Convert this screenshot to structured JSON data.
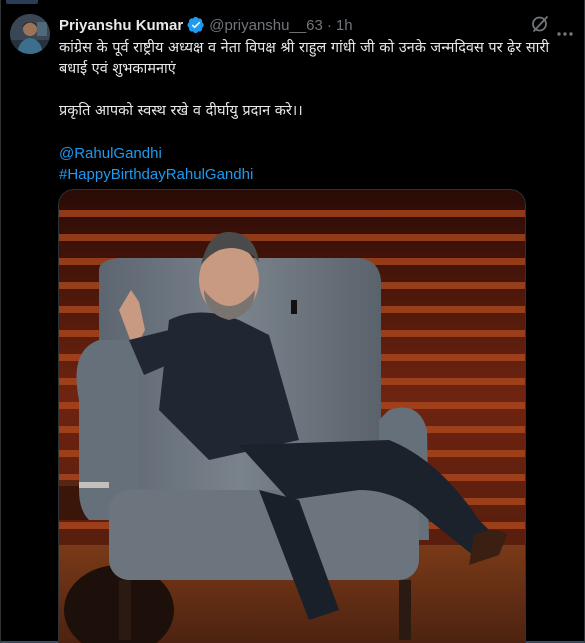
{
  "author": {
    "display_name": "Priyanshu Kumar",
    "handle": "@priyanshu__63",
    "separator": "·",
    "time": "1h",
    "verified": true,
    "verified_color": "#1d9bf0"
  },
  "tweet": {
    "line_1": "कांग्रेस के पूर्व राष्ट्रीय अध्यक्ष व नेता विपक्ष श्री राहुल गांधी जी को उनके जन्मदिवस पर ढ़ेर सारी बधाई एवं शुभकामनाएं",
    "line_2": "प्रकृति आपको स्वस्थ रखे व दीर्घायु प्रदान करे।।",
    "mention": "@RahulGandhi",
    "hashtag": "#HappyBirthdayRahulGandhi"
  },
  "icons": {
    "avatar": "avatar",
    "verified": "verified-badge-icon",
    "grok": "grok-icon",
    "more": "more-icon"
  },
  "colors": {
    "background": "#000000",
    "text": "#e7e9ea",
    "muted": "#71767b",
    "link": "#1d9bf0"
  }
}
